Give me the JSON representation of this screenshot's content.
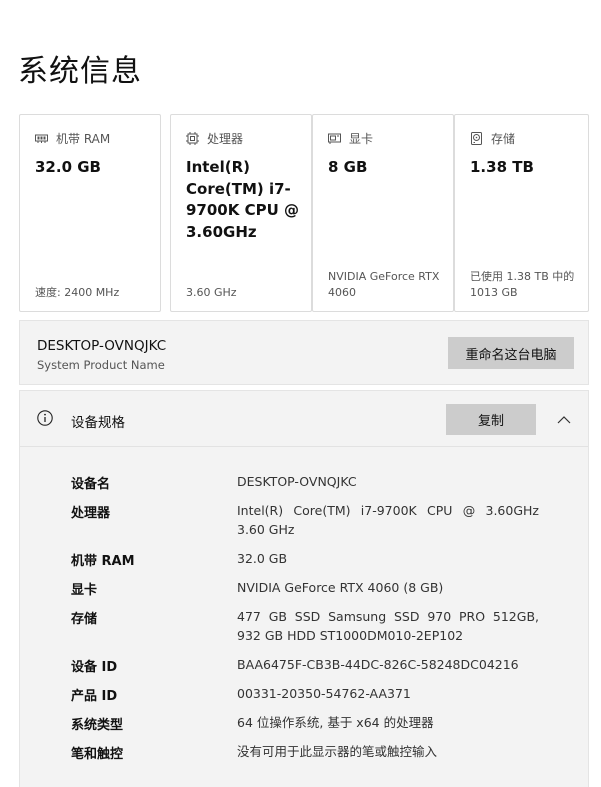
{
  "page": {
    "title": "系统信息"
  },
  "cards": [
    {
      "label": "机带 RAM",
      "icon": "ram-icon",
      "value": "32.0 GB",
      "footer": "速度: 2400 MHz"
    },
    {
      "label": "处理器",
      "icon": "cpu-icon",
      "value": "Intel(R) Core(TM) i7-9700K CPU @ 3.60GHz",
      "footer": "3.60 GHz"
    },
    {
      "label": "显卡",
      "icon": "gpu-icon",
      "value": "8 GB",
      "footer": "NVIDIA GeForce RTX 4060"
    },
    {
      "label": "存储",
      "icon": "storage-icon",
      "value": "1.38 TB",
      "footer": "已使用 1.38 TB 中的 1013 GB"
    }
  ],
  "device": {
    "name": "DESKTOP-OVNQJKC",
    "subtitle": "System Product Name",
    "rename_label": "重命名这台电脑"
  },
  "specs": {
    "title": "设备规格",
    "copy_label": "复制",
    "rows": [
      {
        "key": "设备名",
        "value": "DESKTOP-OVNQJKC"
      },
      {
        "key": "处理器",
        "value": "Intel(R) Core(TM) i7-9700K CPU @ 3.60GHz 3.60 GHz"
      },
      {
        "key": "机带 RAM",
        "value": "32.0 GB"
      },
      {
        "key": "显卡",
        "value": "NVIDIA GeForce RTX 4060 (8 GB)"
      },
      {
        "key": "存储",
        "value": "477 GB SSD Samsung SSD 970 PRO 512GB, 932 GB HDD ST1000DM010-2EP102"
      },
      {
        "key": "设备 ID",
        "value": "BAA6475F-CB3B-44DC-826C-58248DC04216"
      },
      {
        "key": "产品 ID",
        "value": "00331-20350-54762-AA371"
      },
      {
        "key": "系统类型",
        "value": "64 位操作系统, 基于 x64 的处理器"
      },
      {
        "key": "笔和触控",
        "value": "没有可用于此显示器的笔或触控输入"
      }
    ]
  },
  "colors": {
    "button": "#cccccc",
    "panel": "#f3f3f3",
    "border": "#dcdcdc"
  }
}
